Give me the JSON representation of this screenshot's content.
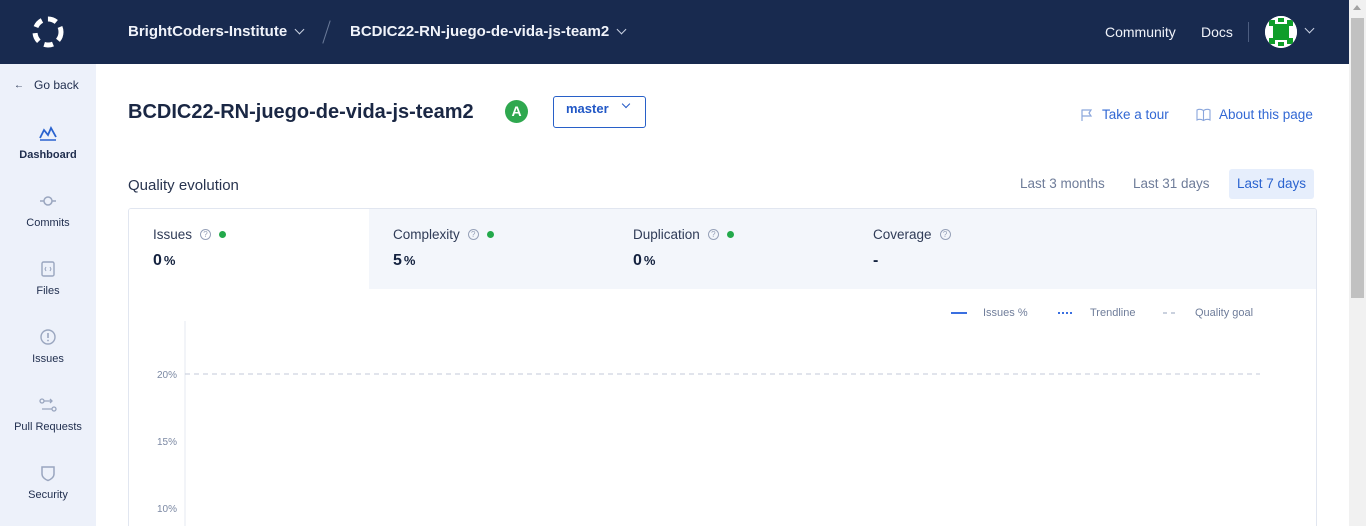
{
  "header": {
    "org": "BrightCoders-Institute",
    "repo": "BCDIC22-RN-juego-de-vida-js-team2",
    "community": "Community",
    "docs": "Docs"
  },
  "sidebar": {
    "go_back": "Go back",
    "items": [
      {
        "label": "Dashboard",
        "icon": "dashboard-icon",
        "active": true
      },
      {
        "label": "Commits",
        "icon": "commit-icon"
      },
      {
        "label": "Files",
        "icon": "file-icon"
      },
      {
        "label": "Issues",
        "icon": "issue-icon"
      },
      {
        "label": "Pull Requests",
        "icon": "pull-request-icon"
      },
      {
        "label": "Security",
        "icon": "shield-icon"
      }
    ]
  },
  "main": {
    "title": "BCDIC22-RN-juego-de-vida-js-team2",
    "grade": "A",
    "branch": "master",
    "take_tour": "Take a tour",
    "about": "About this page",
    "quality_evolution": "Quality evolution",
    "ranges": [
      "Last 3 months",
      "Last 31 days",
      "Last 7 days"
    ],
    "selected_range": "Last 7 days",
    "metrics": [
      {
        "name": "Issues",
        "value": "0",
        "unit": "%",
        "status": "green"
      },
      {
        "name": "Complexity",
        "value": "5",
        "unit": "%",
        "status": "green"
      },
      {
        "name": "Duplication",
        "value": "0",
        "unit": "%",
        "status": "green"
      },
      {
        "name": "Coverage",
        "value": "-",
        "unit": ""
      }
    ]
  },
  "chart_data": {
    "type": "line",
    "series": [
      {
        "name": "Issues %",
        "values": []
      },
      {
        "name": "Trendline",
        "values": []
      },
      {
        "name": "Quality goal",
        "values": [
          20
        ]
      }
    ],
    "y_ticks": [
      "20%",
      "15%",
      "10%"
    ],
    "legend_position": "top-right"
  },
  "colors": {
    "topbar": "#182a4f",
    "accent": "#2a63cf",
    "grade_green": "#2fa84f",
    "status_green": "#23a94b"
  }
}
